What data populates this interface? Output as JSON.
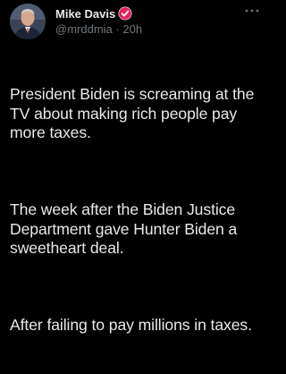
{
  "author": {
    "name": "Mike Davis",
    "handle": "@mrddmia",
    "separator": "·",
    "time": "20h",
    "verified_color": "#e0245e"
  },
  "tweet": {
    "paragraphs": [
      "President Biden is screaming at the TV about making rich people pay more taxes.",
      "The week after the Biden Justice Department gave Hunter Biden a sweetheart deal.",
      "After failing to pay millions in taxes."
    ]
  },
  "icons": {
    "avatar": "profile-photo",
    "verified": "verified-badge-icon",
    "more": "more-options-icon"
  },
  "colors": {
    "background": "#000000",
    "text": "#e7e9ea",
    "secondary_text": "#71767b"
  }
}
